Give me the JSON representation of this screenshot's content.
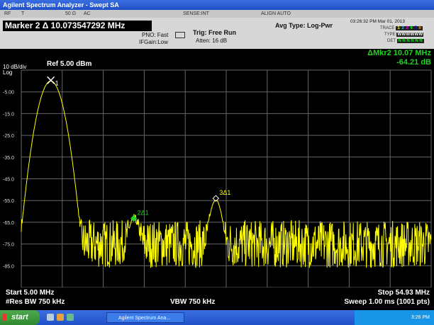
{
  "window": {
    "title": "Agilent Spectrum Analyzer - Swept SA"
  },
  "menu_strip": {
    "items": [
      "RF",
      "T",
      "50 Ω",
      "AC",
      "SENSE:INT",
      "ALIGN AUTO"
    ]
  },
  "header": {
    "marker_label": "Marker 2 Δ 10.073547292 MHz",
    "pno": "PNO: Fast",
    "ifgain": "IFGain:Low",
    "trig": "Trig: Free Run",
    "atten": "Atten: 16 dB",
    "avg_type": "Avg Type: Log-Pwr",
    "datetime": "03:26:32 PM Mar 01, 2013",
    "trace_label": "TRACE",
    "type_label": "TYPE",
    "det_label": "DET",
    "trace_nums": [
      "1",
      "2",
      "3",
      "4",
      "5",
      "6"
    ],
    "type_vals": [
      "W",
      "W",
      "W",
      "W",
      "W",
      "W"
    ],
    "det_vals": [
      "N",
      "N",
      "N",
      "N",
      "N",
      "N"
    ]
  },
  "plot": {
    "scale": "10 dB/div",
    "log": "Log",
    "ref_level": "Ref 5.00 dBm",
    "delta_marker_freq": "ΔMkr2 10.07 MHz",
    "delta_marker_amp": "-64.21 dB",
    "grid": true
  },
  "chart_data": {
    "type": "line",
    "xlabel": "",
    "ylabel": "",
    "y_tick_labels": [
      "-5.00",
      "-15.0",
      "-25.0",
      "-35.0",
      "-45.0",
      "-55.0",
      "-65.0",
      "-75.0",
      "-85.0"
    ],
    "xlim": [
      5.0,
      54.93
    ],
    "ylim": [
      -95,
      5
    ],
    "series": [
      {
        "color": "#ffff00",
        "peaks": [
          {
            "x": 8.6,
            "y": 0.0
          },
          {
            "x": 18.7,
            "y": -64.2
          },
          {
            "x": 28.7,
            "y": -55.0
          }
        ],
        "noise_floor": -75
      }
    ],
    "markers": [
      {
        "label": "1",
        "x": 8.6,
        "y": 0.0,
        "color": "#ffffff"
      },
      {
        "label": "2Δ1",
        "x": 18.7,
        "y": -64.2,
        "color": "#22d322"
      },
      {
        "label": "3Δ1",
        "x": 28.7,
        "y": -55.0,
        "color": "#ffffff"
      }
    ]
  },
  "footer": {
    "start": "Start 5.00 MHz",
    "stop": "Stop 54.93 MHz",
    "res_bw": "#Res BW 750 kHz",
    "vbw": "VBW 750 kHz",
    "sweep": "Sweep  1.00 ms (1001 pts)"
  },
  "taskbar": {
    "start_label": "start",
    "task_label": "Agilent Spectrum Ana...",
    "clock": "3:26 PM"
  }
}
